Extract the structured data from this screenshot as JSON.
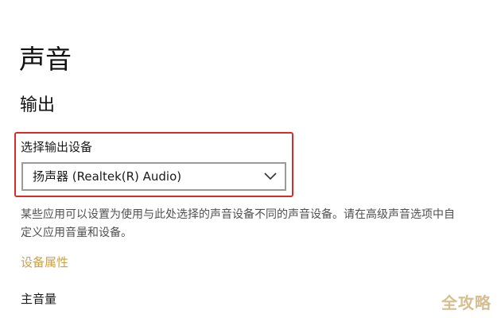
{
  "page": {
    "title": "声音"
  },
  "output_section": {
    "title": "输出",
    "select_label": "选择输出设备",
    "selected_device": "扬声器 (Realtek(R) Audio)",
    "dropdown_icon": "chevron-down-icon",
    "description": "某些应用可以设置为使用与此处选择的声音设备不同的声音设备。请在高级声音选项中自定义应用音量和设备。",
    "device_properties_link": "设备属性",
    "master_volume_label": "主音量"
  },
  "watermark": "全攻略",
  "colors": {
    "highlight_border": "#d62c2c",
    "link": "#c8a24a",
    "select_border": "#9a9a9a"
  }
}
